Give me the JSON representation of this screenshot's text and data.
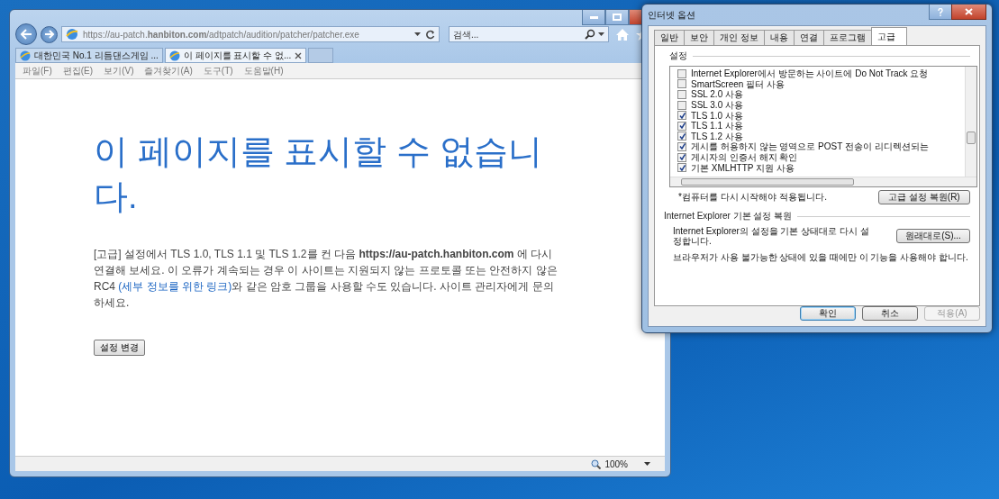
{
  "browser": {
    "address": "https://au-patch.**hanbiton.com**/adtpatch/audition/patcher/patcher.exe",
    "search_placeholder": "검색...",
    "tabs": [
      {
        "label": "대한민국 No.1 리듬댄스게임 ...",
        "selected": false
      },
      {
        "label": "이 페이지를 표시할 수 없...",
        "selected": true
      }
    ],
    "menu": [
      "파일(F)",
      "편집(E)",
      "보기(V)",
      "즐겨찾기(A)",
      "도구(T)",
      "도움말(H)"
    ],
    "page": {
      "heading": "이 페이지를 표시할 수 없습니다.",
      "text_before": "[고급] 설정에서 TLS 1.0, TLS 1.1 및 TLS 1.2를 컨 다음 **https://au-patch.hanbiton.com** 에 다시 연결해 보세요. 이 오류가 계속되는 경우 이 사이트는 지원되지 않는 프로토콜 또는 안전하지 않은 RC4 ",
      "link": "(세부 정보를 위한 링크)",
      "text_after": "와 같은 암호 그룹을 사용할 수도 있습니다. 사이트 관리자에게 문의하세요.",
      "button": "설정 변경"
    },
    "zoom": "100%"
  },
  "dialog": {
    "title": "인터넷 옵션",
    "tabs": [
      {
        "label": "일반",
        "selected": false
      },
      {
        "label": "보안",
        "selected": false
      },
      {
        "label": "개인 정보",
        "selected": false
      },
      {
        "label": "내용",
        "selected": false
      },
      {
        "label": "연결",
        "selected": false
      },
      {
        "label": "프로그램",
        "selected": false
      },
      {
        "label": "고급",
        "selected": true
      }
    ],
    "settings_label": "설정",
    "settings": [
      {
        "label": "Internet Explorer에서 방문하는 사이트에 Do Not Track 요청",
        "checked": false
      },
      {
        "label": "SmartScreen 필터 사용",
        "checked": false
      },
      {
        "label": "SSL 2.0 사용",
        "checked": false
      },
      {
        "label": "SSL 3.0 사용",
        "checked": false
      },
      {
        "label": "TLS 1.0 사용",
        "checked": true
      },
      {
        "label": "TLS 1.1 사용",
        "checked": true
      },
      {
        "label": "TLS 1.2 사용",
        "checked": true
      },
      {
        "label": "게시를 허용하지 않는 영역으로 POST 전송이 리디렉션되는",
        "checked": true
      },
      {
        "label": "게시자의 인증서 해지 확인",
        "checked": true
      },
      {
        "label": "기본 XMLHTTP 지원 사용",
        "checked": true
      }
    ],
    "restart_note": "*컴퓨터를 다시 시작해야 적용됩니다.",
    "restore_advanced": "고급 설정 복원(R)",
    "reset_group": "Internet Explorer 기본 설정 복원",
    "reset_text": "Internet Explorer의 설정을 기본 상태대로 다시 설정합니다.",
    "reset_button": "원래대로(S)...",
    "reset_warning": "브라우저가 사용 불가능한 상태에 있을 때에만 이 기능을 사용해야 합니다.",
    "buttons": [
      {
        "label": "확인",
        "disabled": false
      },
      {
        "label": "취소",
        "disabled": false
      },
      {
        "label": "적용(A)",
        "disabled": true
      }
    ]
  }
}
